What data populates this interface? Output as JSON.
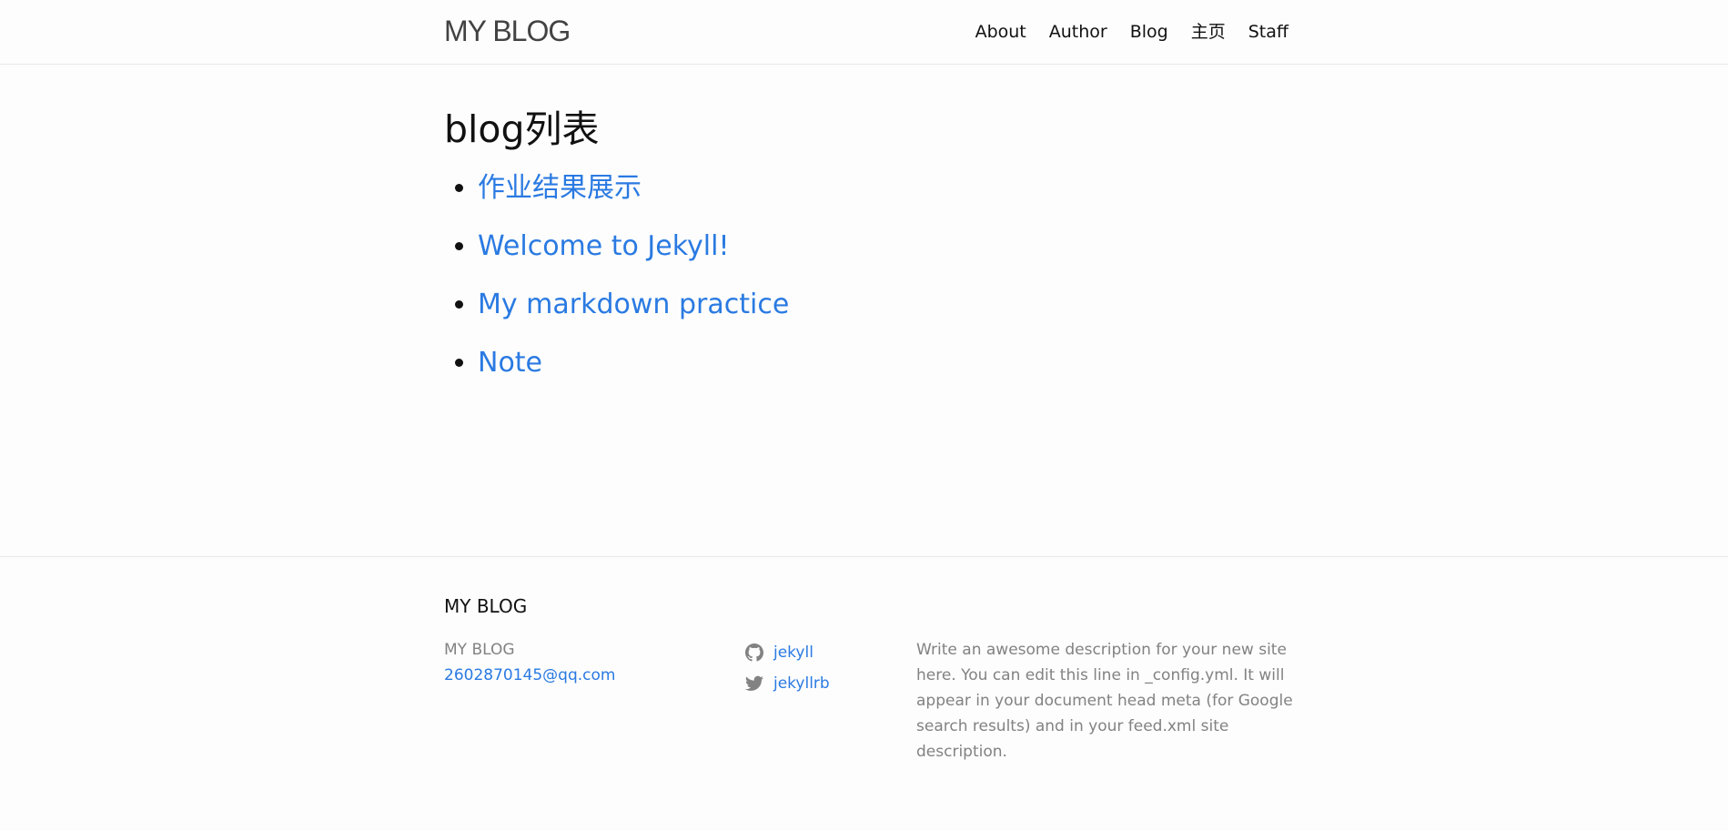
{
  "header": {
    "site_title": "MY BLOG",
    "nav": [
      {
        "label": "About"
      },
      {
        "label": "Author"
      },
      {
        "label": "Blog"
      },
      {
        "label": "主页"
      },
      {
        "label": "Staff"
      }
    ]
  },
  "main": {
    "heading": "blog列表",
    "posts": [
      {
        "title": "作业结果展示"
      },
      {
        "title": "Welcome to Jekyll!"
      },
      {
        "title": "My markdown practice"
      },
      {
        "title": "Note"
      }
    ]
  },
  "footer": {
    "heading": "MY BLOG",
    "name": "MY BLOG",
    "email": "2602870145@qq.com",
    "social": [
      {
        "icon": "github-icon",
        "label": "jekyll"
      },
      {
        "icon": "twitter-icon",
        "label": "jekyllrb"
      }
    ],
    "description": "Write an awesome description for your new site here. You can edit this line in _config.yml. It will appear in your document head meta (for Google search results) and in your feed.xml site description."
  },
  "colors": {
    "link": "#2a7ae2",
    "text": "#111111",
    "muted": "#828282",
    "border": "#e8e8e8",
    "background": "#fdfdfd"
  }
}
